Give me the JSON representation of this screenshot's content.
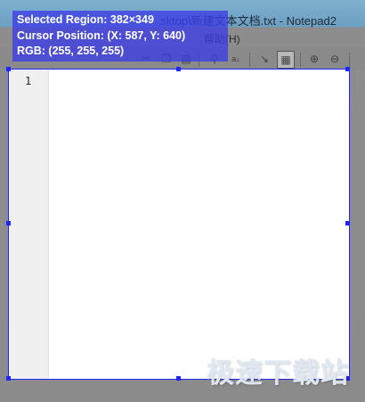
{
  "window": {
    "title_fragment": "sktop\\新建文本文档.txt - Notepad2",
    "menu_fragment": "帮助(H)"
  },
  "overlay": {
    "selected_region": "Selected Region: 382×349",
    "cursor_position": "Cursor Position: (X: 587, Y: 640)",
    "rgb": "RGB: (255, 255, 255)"
  },
  "editor": {
    "line_numbers": [
      "1"
    ]
  },
  "toolbar": {
    "icons": [
      "cut-icon",
      "copy-icon",
      "paste-icon",
      "find-icon",
      "replace-icon",
      "wrap-icon",
      "zoom-in-icon",
      "zoom-out-icon"
    ]
  },
  "watermark": "极速下载站",
  "colors": {
    "selection_border": "#1e25ff",
    "overlay_bg": "#3c3ce6"
  }
}
